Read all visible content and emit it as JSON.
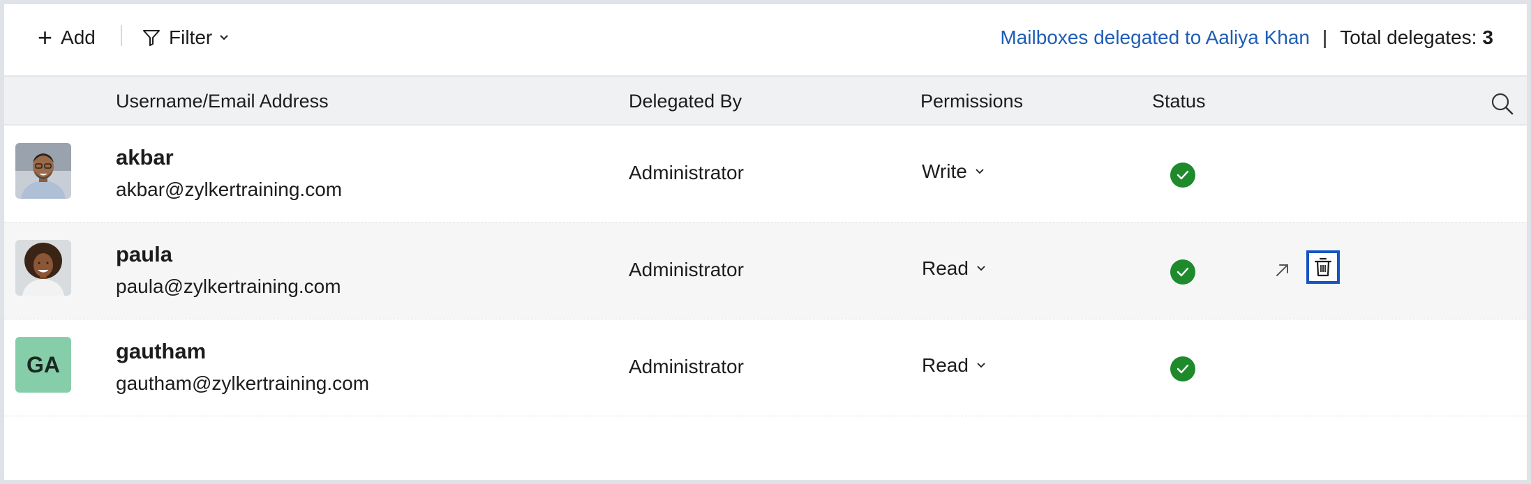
{
  "toolbar": {
    "add_label": "Add",
    "filter_label": "Filter",
    "mailboxes_link": "Mailboxes delegated to Aaliya Khan",
    "separator": "|",
    "total_label": "Total delegates:",
    "total_count": "3"
  },
  "table": {
    "columns": {
      "username": "Username/Email Address",
      "delegated_by": "Delegated By",
      "permissions": "Permissions",
      "status": "Status"
    },
    "rows": [
      {
        "username": "akbar",
        "email": "akbar@zylkertraining.com",
        "delegated_by": "Administrator",
        "permission": "Write",
        "status": "active",
        "avatar": "photo"
      },
      {
        "username": "paula",
        "email": "paula@zylkertraining.com",
        "delegated_by": "Administrator",
        "permission": "Read",
        "status": "active",
        "avatar": "photo"
      },
      {
        "username": "gautham",
        "email": "gautham@zylkertraining.com",
        "delegated_by": "Administrator",
        "permission": "Read",
        "status": "active",
        "avatar": "initials",
        "initials": "GA"
      }
    ]
  },
  "colors": {
    "link": "#1f5db8",
    "status_green": "#1e8a2c",
    "focus_border": "#1454c4",
    "initials_bg": "#86ceaa",
    "header_bg": "#f0f1f3"
  },
  "icons": {
    "add": "plus-icon",
    "filter": "funnel-icon",
    "dropdown": "chevron-down-icon",
    "search": "search-icon",
    "status": "check-circle-icon",
    "open": "arrow-up-right-icon",
    "delete": "trash-icon"
  }
}
